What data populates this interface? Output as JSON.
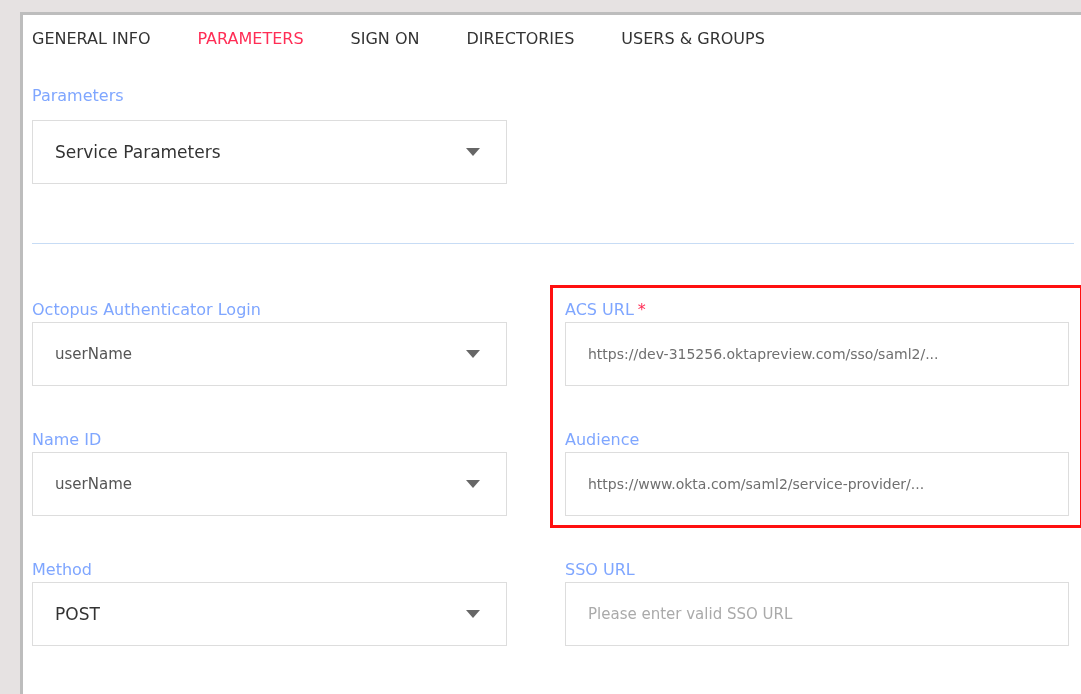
{
  "tabs": [
    {
      "label": "GENERAL INFO",
      "selected": false
    },
    {
      "label": "PARAMETERS",
      "selected": true
    },
    {
      "label": "SIGN ON",
      "selected": false
    },
    {
      "label": "DIRECTORIES",
      "selected": false
    },
    {
      "label": "USERS & GROUPS",
      "selected": false
    }
  ],
  "parameters": {
    "label": "Parameters",
    "kind": "select",
    "value": "Service Parameters"
  },
  "left_fields": [
    {
      "label": "Octopus Authenticator Login",
      "kind": "select",
      "value": "userName"
    },
    {
      "label": "Name ID",
      "kind": "select",
      "value": "userName"
    },
    {
      "label": "Method",
      "kind": "select",
      "value": "POST"
    }
  ],
  "highlight_box": {
    "fields": [
      {
        "label": "ACS URL",
        "required_mark": "*",
        "kind": "text",
        "value": "https://dev-315256.oktapreview.com/sso/saml2/..."
      },
      {
        "label": "Audience",
        "kind": "text",
        "value": "https://www.okta.com/saml2/service-provider/..."
      }
    ]
  },
  "right_fields": [
    {
      "label": "SSO URL",
      "kind": "text",
      "placeholder": "Please enter valid SSO URL"
    }
  ]
}
